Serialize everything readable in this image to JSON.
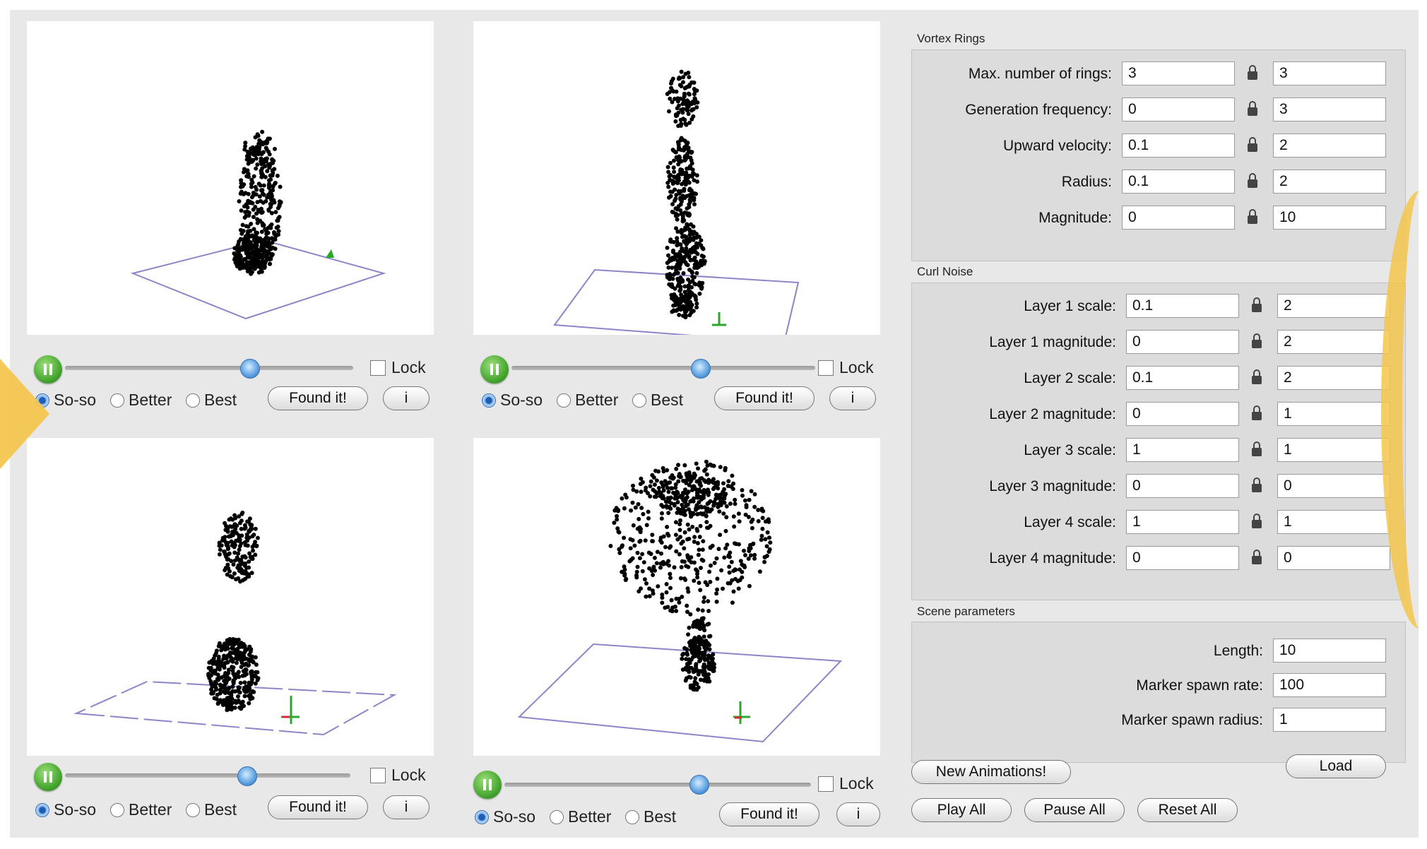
{
  "colors": {
    "accent": "#f4c64e",
    "play": "#3c9e27",
    "slider_thumb": "#5a9fe0"
  },
  "viewports": [
    {
      "lock_label": "Lock",
      "radio_options": [
        "So-so",
        "Better",
        "Best"
      ],
      "selected": "So-so",
      "found_label": "Found it!",
      "info_label": "i",
      "play_icon": "pause-icon"
    },
    {
      "lock_label": "Lock",
      "radio_options": [
        "So-so",
        "Better",
        "Best"
      ],
      "selected": "So-so",
      "found_label": "Found it!",
      "info_label": "i",
      "play_icon": "pause-icon"
    },
    {
      "lock_label": "Lock",
      "radio_options": [
        "So-so",
        "Better",
        "Best"
      ],
      "selected": "So-so",
      "found_label": "Found it!",
      "info_label": "i",
      "play_icon": "pause-icon"
    },
    {
      "lock_label": "Lock",
      "radio_options": [
        "So-so",
        "Better",
        "Best"
      ],
      "selected": "So-so",
      "found_label": "Found it!",
      "info_label": "i",
      "play_icon": "pause-icon"
    }
  ],
  "vortex_rings": {
    "title": "Vortex Rings",
    "rows": [
      {
        "label": "Max. number of rings:",
        "min": "3",
        "max": "3"
      },
      {
        "label": "Generation frequency:",
        "min": "0",
        "max": "3"
      },
      {
        "label": "Upward velocity:",
        "min": "0.1",
        "max": "2"
      },
      {
        "label": "Radius:",
        "min": "0.1",
        "max": "2"
      },
      {
        "label": "Magnitude:",
        "min": "0",
        "max": "10"
      }
    ]
  },
  "curl_noise": {
    "title": "Curl Noise",
    "rows": [
      {
        "label": "Layer 1 scale:",
        "min": "0.1",
        "max": "2"
      },
      {
        "label": "Layer 1 magnitude:",
        "min": "0",
        "max": "2"
      },
      {
        "label": "Layer 2 scale:",
        "min": "0.1",
        "max": "2"
      },
      {
        "label": "Layer 2 magnitude:",
        "min": "0",
        "max": "1"
      },
      {
        "label": "Layer 3 scale:",
        "min": "1",
        "max": "1"
      },
      {
        "label": "Layer 3 magnitude:",
        "min": "0",
        "max": "0"
      },
      {
        "label": "Layer 4 scale:",
        "min": "1",
        "max": "1"
      },
      {
        "label": "Layer 4 magnitude:",
        "min": "0",
        "max": "0"
      }
    ]
  },
  "scene_parameters": {
    "title": "Scene parameters",
    "rows": [
      {
        "label": "Length:",
        "value": "10"
      },
      {
        "label": "Marker spawn rate:",
        "value": "100"
      },
      {
        "label": "Marker spawn radius:",
        "value": "1"
      }
    ]
  },
  "buttons": {
    "new_animations": "New Animations!",
    "load": "Load",
    "play_all": "Play All",
    "pause_all": "Pause All",
    "reset_all": "Reset All"
  }
}
